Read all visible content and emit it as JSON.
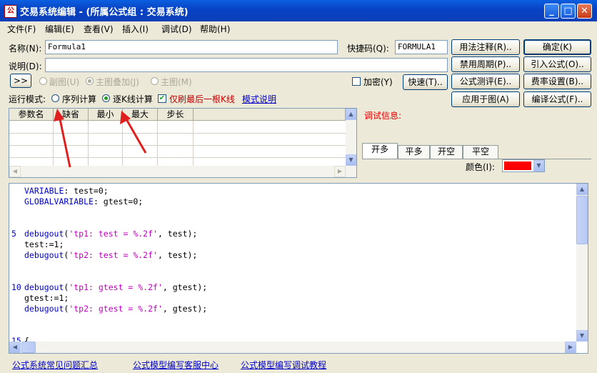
{
  "window": {
    "title": "交易系统编辑 - (所属公式组 : 交易系统)",
    "app_icon": "formula-editor-icon"
  },
  "menu": [
    "文件(F)",
    "编辑(E)",
    "查看(V)",
    "插入(I)",
    "调试(D)",
    "帮助(H)"
  ],
  "form": {
    "name_label": "名称(N):",
    "name_value": "Formula1",
    "shortcut_label": "快捷码(Q):",
    "shortcut_value": "FORMULA1",
    "desc_label": "说明(D):",
    "desc_value": ""
  },
  "buttons": {
    "usage_note": "用法注释(R)..",
    "ok": "确定(K)",
    "disable_period": "禁用周期(P)..",
    "import_formula": "引入公式(O)..",
    "fast": "快速(T)..",
    "formula_eval": "公式测评(E)..",
    "fee_setting": "费率设置(B)..",
    "apply_to_chart": "应用于图(A)",
    "compile": "编译公式(F)..",
    "expand": ">>"
  },
  "chart_mode": {
    "sub_chart": "副图(U)",
    "overlay": "主图叠加(J)",
    "main_chart": "主图(M)",
    "selected": "主图叠加(J)",
    "encrypt_label": "加密(Y)",
    "encrypt_checked": false
  },
  "run_mode": {
    "label": "运行模式:",
    "sequence": "序列计算",
    "per_bar": "逐K线计算",
    "selected": "逐K线计算",
    "last_bar_only": "仅刷最后一根K线",
    "last_bar_checked": true,
    "mode_help_link": "模式说明"
  },
  "params_table": {
    "headers": [
      "参数名",
      "缺省",
      "最小",
      "最大",
      "步长"
    ],
    "rows": []
  },
  "debug": {
    "label": "调试信息:",
    "tabs": [
      "开多",
      "平多",
      "开空",
      "平空"
    ],
    "active_tab": "开多",
    "color_label": "颜色(I):",
    "color_value": "#ff0000"
  },
  "editor": {
    "lines": [
      {
        "n": "",
        "parts": [
          [
            "kw",
            "VARIABLE"
          ],
          [
            "bl",
            ": test=0;"
          ]
        ]
      },
      {
        "n": "",
        "parts": [
          [
            "kw",
            "GLOBALVARIABLE"
          ],
          [
            "bl",
            ": gtest=0;"
          ]
        ]
      },
      {
        "n": "",
        "parts": []
      },
      {
        "n": "",
        "parts": []
      },
      {
        "n": "5",
        "parts": [
          [
            "kw",
            "debugout"
          ],
          [
            "bl",
            "("
          ],
          [
            "str",
            "'tp1: test = %.2f'"
          ],
          [
            "bl",
            ", test);"
          ]
        ]
      },
      {
        "n": "",
        "parts": [
          [
            "bl",
            "test:=1;"
          ]
        ]
      },
      {
        "n": "",
        "parts": [
          [
            "kw",
            "debugout"
          ],
          [
            "bl",
            "("
          ],
          [
            "str",
            "'tp2: test = %.2f'"
          ],
          [
            "bl",
            ", test);"
          ]
        ]
      },
      {
        "n": "",
        "parts": []
      },
      {
        "n": "",
        "parts": []
      },
      {
        "n": "10",
        "parts": [
          [
            "kw",
            "debugout"
          ],
          [
            "bl",
            "("
          ],
          [
            "str",
            "'tp1: gtest = %.2f'"
          ],
          [
            "bl",
            ", gtest);"
          ]
        ]
      },
      {
        "n": "",
        "parts": [
          [
            "bl",
            "gtest:=1;"
          ]
        ]
      },
      {
        "n": "",
        "parts": [
          [
            "kw",
            "debugout"
          ],
          [
            "bl",
            "("
          ],
          [
            "str",
            "'tp2: gtest = %.2f'"
          ],
          [
            "bl",
            ", gtest);"
          ]
        ]
      },
      {
        "n": "",
        "parts": []
      },
      {
        "n": "",
        "parts": []
      },
      {
        "n": "15",
        "parts": [
          [
            "bl",
            "{"
          ]
        ]
      }
    ]
  },
  "footer_links": [
    "公式系统常见问题汇总",
    "公式模型编写客服中心",
    "公式模型编写调试教程"
  ],
  "colors": {
    "titlebar": "#0a4fd4",
    "window_bg": "#ece9d8",
    "keyword": "#0000c8",
    "string": "#c000c0",
    "annotation_arrow": "#e0201e"
  }
}
